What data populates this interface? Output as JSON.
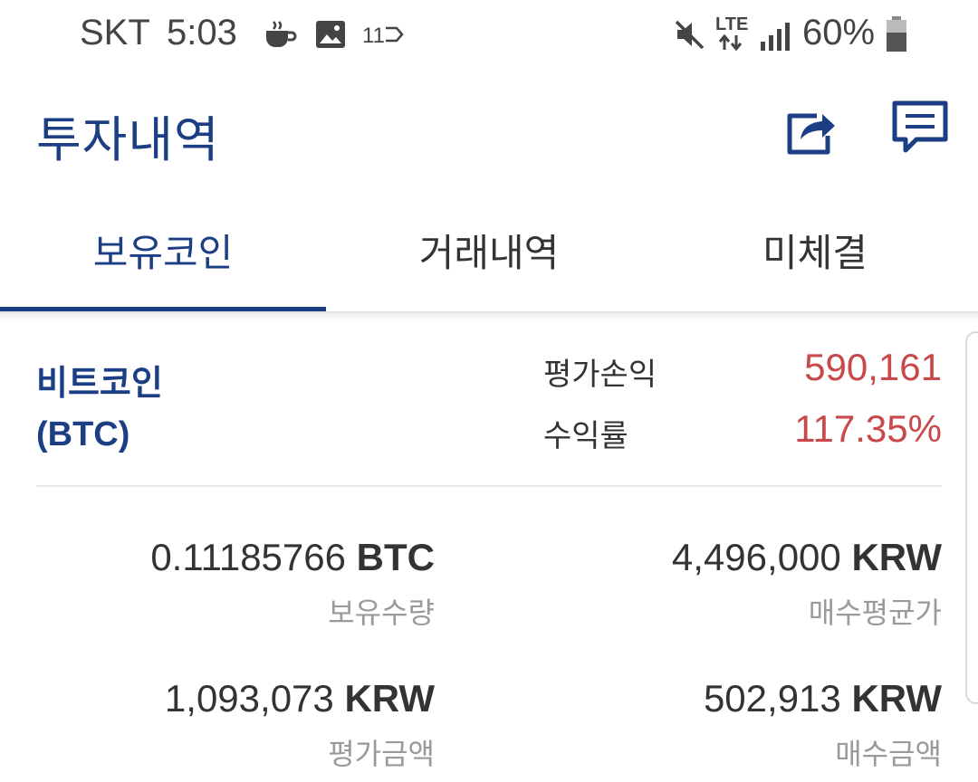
{
  "status_bar": {
    "carrier": "SKT",
    "time": "5:03",
    "notif_count": "11",
    "network": "LTE",
    "battery": "60%"
  },
  "header": {
    "title": "투자내역",
    "icons": [
      "share-icon",
      "chat-icon"
    ]
  },
  "tabs": [
    {
      "label": "보유코인",
      "active": true
    },
    {
      "label": "거래내역",
      "active": false
    },
    {
      "label": "미체결",
      "active": false
    }
  ],
  "coin": {
    "name": "비트코인",
    "symbol": "(BTC)",
    "pnl_label": "평가손익",
    "pnl_value": "590,161",
    "return_label": "수익률",
    "return_value": "117.35%"
  },
  "stats": {
    "holding": {
      "value": "0.11185766",
      "unit": "BTC",
      "label": "보유수량"
    },
    "avg_price": {
      "value": "4,496,000",
      "unit": "KRW",
      "label": "매수평균가"
    },
    "eval_amount": {
      "value": "1,093,073",
      "unit": "KRW",
      "label": "평가금액"
    },
    "buy_amount": {
      "value": "502,913",
      "unit": "KRW",
      "label": "매수금액"
    }
  },
  "colors": {
    "brand": "#1b3e84",
    "profit": "#c8494b"
  }
}
